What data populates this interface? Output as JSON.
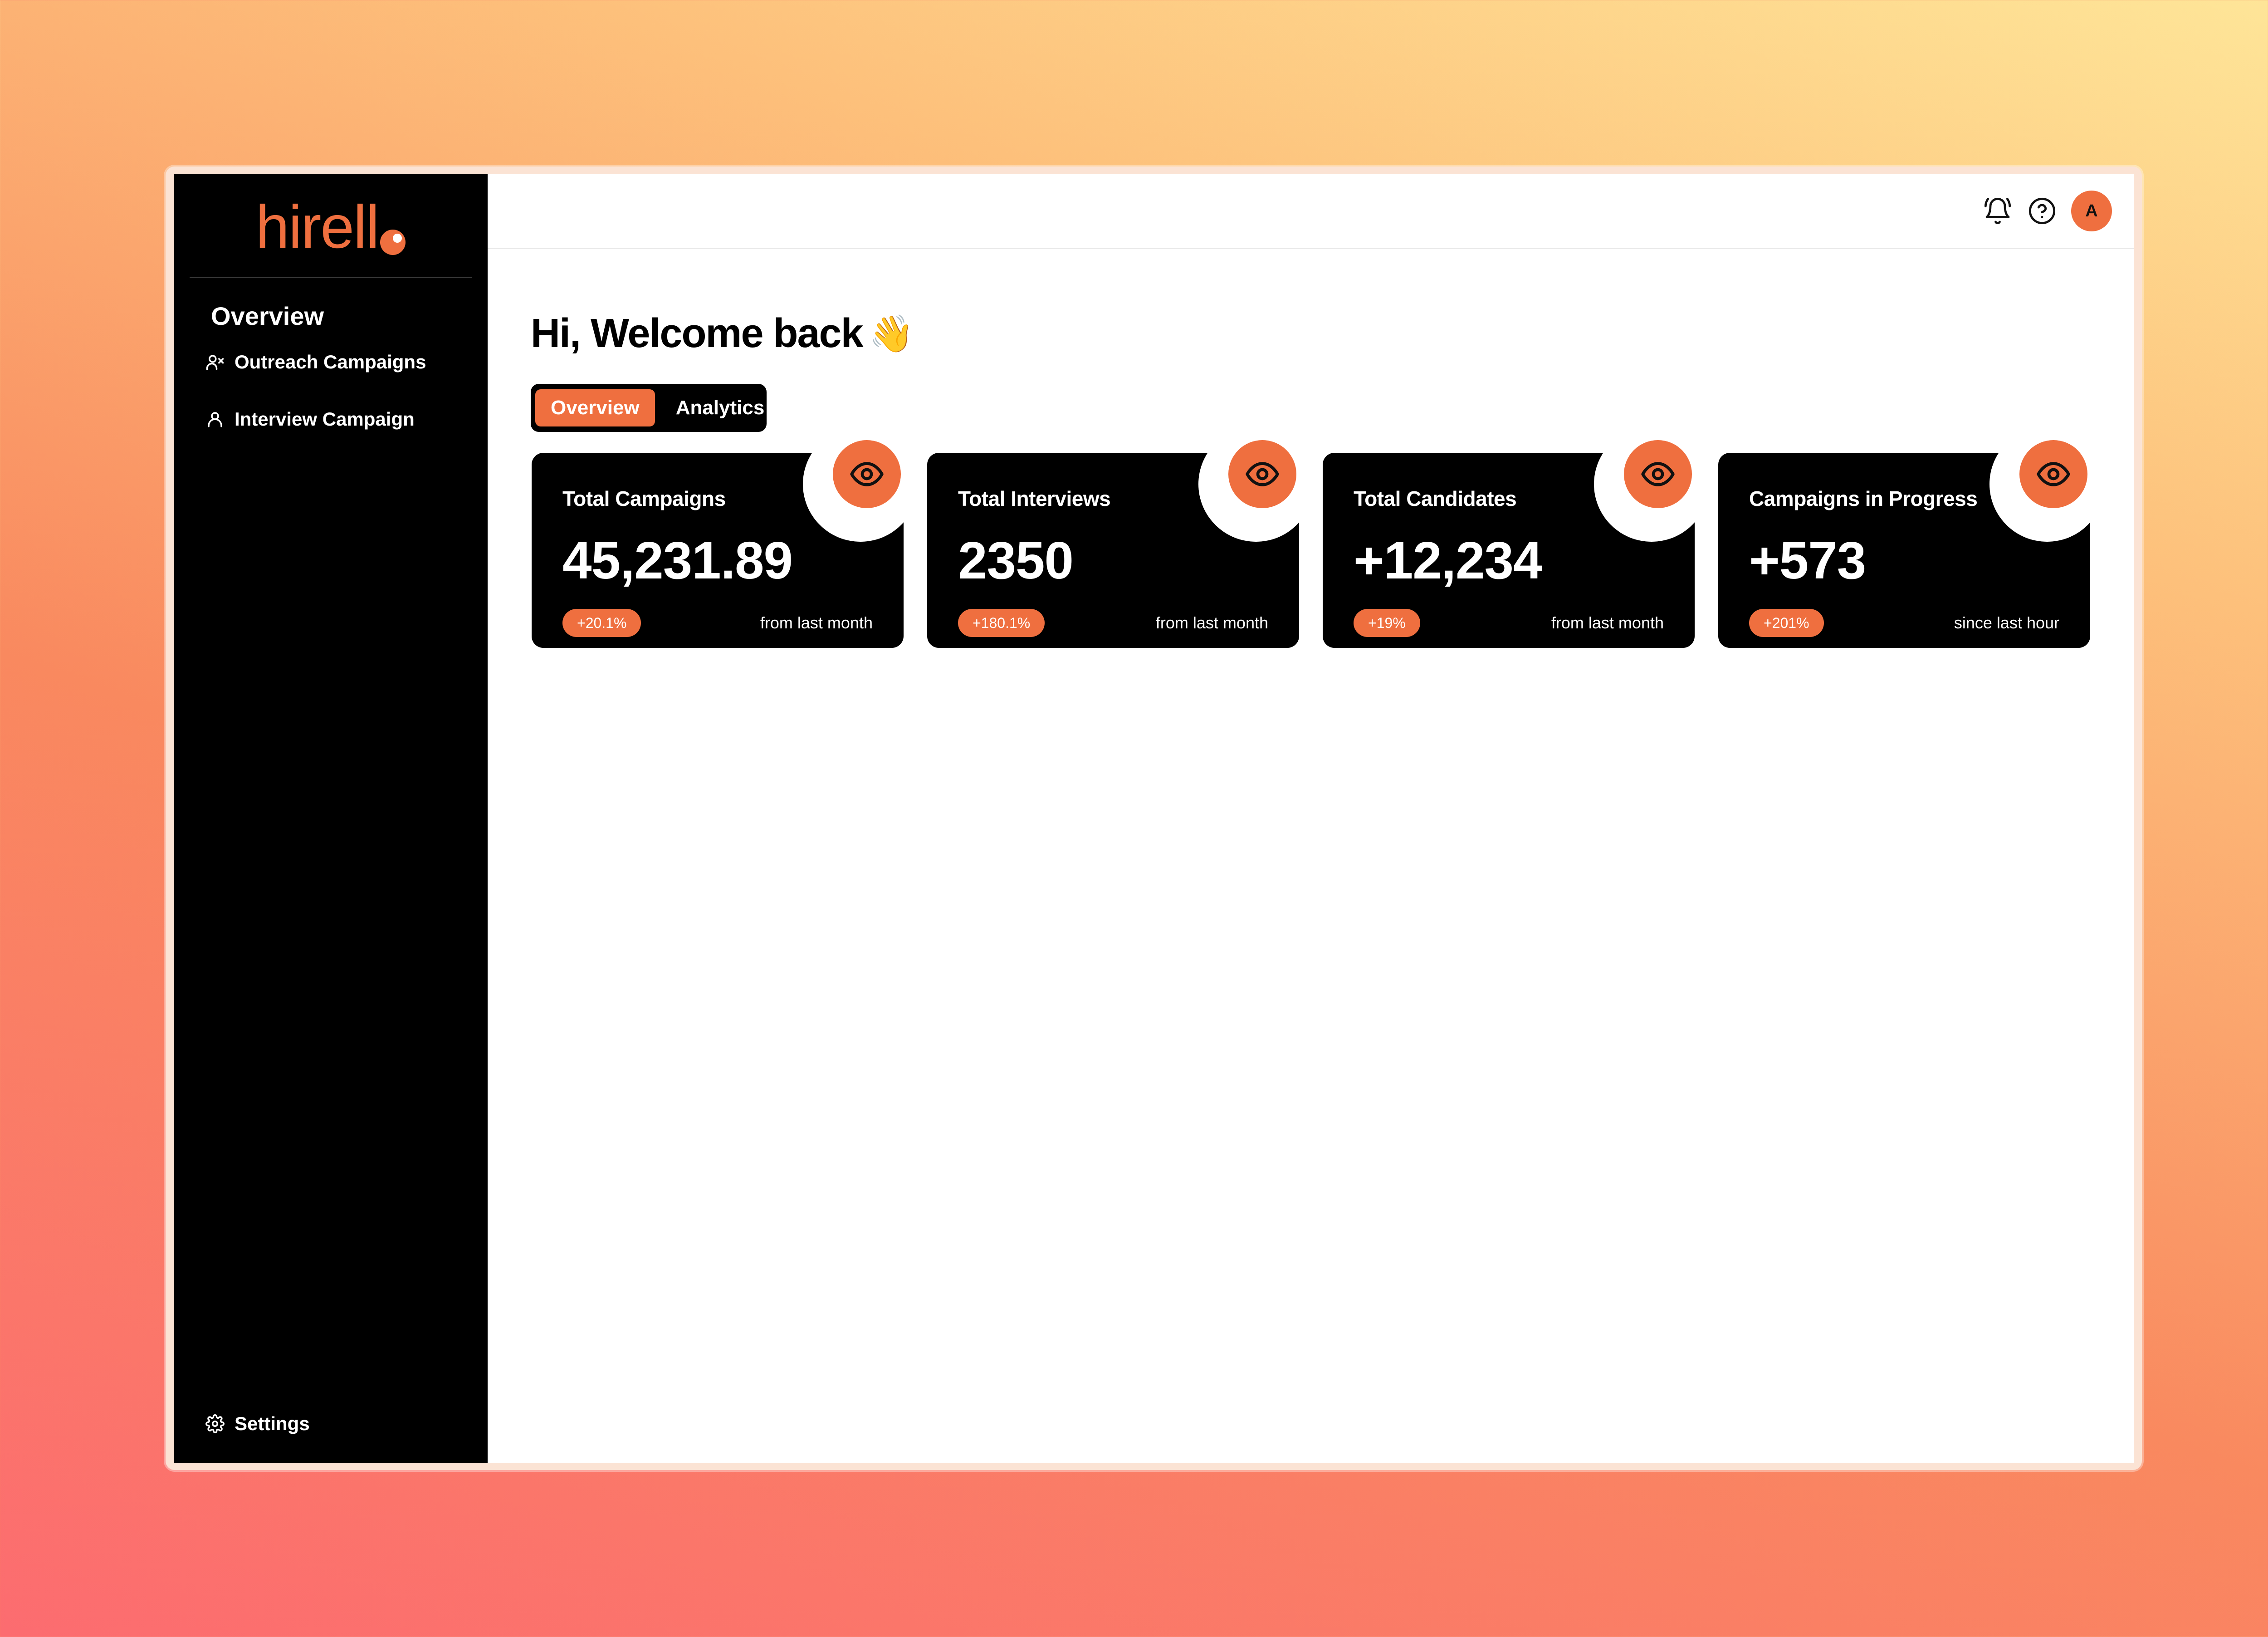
{
  "app": {
    "logo_text": "hirell"
  },
  "sidebar": {
    "heading": "Overview",
    "items": [
      {
        "label": "Outreach Campaigns",
        "icon": "users-x-icon"
      },
      {
        "label": "Interview Campaign",
        "icon": "user-icon"
      }
    ],
    "footer_item": {
      "label": "Settings",
      "icon": "gear-icon"
    }
  },
  "topbar": {
    "icons": [
      "bell-icon",
      "help-icon"
    ],
    "avatar_initial": "A"
  },
  "main": {
    "greeting": "Hi, Welcome back",
    "greeting_emoji": "👋",
    "tabs": [
      {
        "label": "Overview",
        "active": true
      },
      {
        "label": "Analytics",
        "active": false
      }
    ],
    "cards": [
      {
        "title": "Total Campaigns",
        "value": "45,231.89",
        "badge": "+20.1%",
        "note": "from last month",
        "icon": "eye-icon"
      },
      {
        "title": "Total Interviews",
        "value": "2350",
        "badge": "+180.1%",
        "note": "from last month",
        "icon": "eye-icon"
      },
      {
        "title": "Total Candidates",
        "value": "+12,234",
        "badge": "+19%",
        "note": "from last month",
        "icon": "eye-icon"
      },
      {
        "title": "Campaigns in Progress",
        "value": "+573",
        "badge": "+201%",
        "note": "since last hour",
        "icon": "eye-icon"
      }
    ]
  },
  "colors": {
    "accent": "#ef6f3f",
    "sidebar_bg": "#000000",
    "card_bg": "#000000",
    "background_gradient_start": "#fc6c70",
    "background_gradient_end": "#fee598"
  }
}
